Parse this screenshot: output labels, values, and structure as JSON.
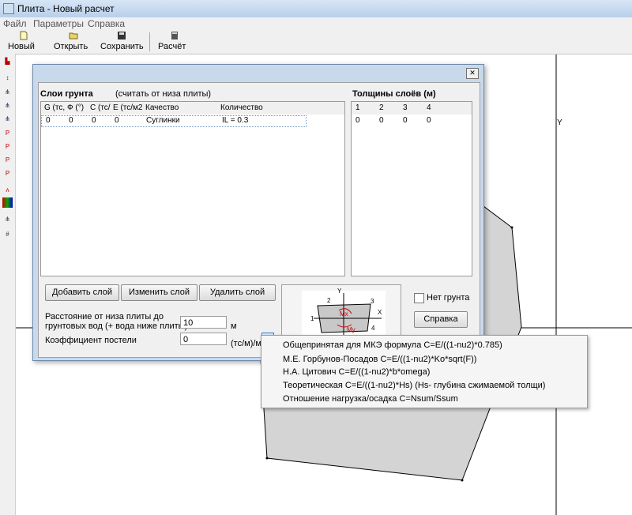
{
  "window": {
    "title": "Плита - Новый расчет"
  },
  "menu": [
    "Файл",
    "Параметры",
    "Справка"
  ],
  "toolbar": {
    "new": "Новый",
    "open": "Открыть",
    "save": "Сохранить",
    "calc": "Расчёт"
  },
  "canvas": {
    "y_axis_label": "Y"
  },
  "dialog": {
    "close_glyph": "✕",
    "layers_title": "Слои грунта",
    "layers_note": "(считать от низа плиты)",
    "layers_columns": [
      "G (тс,",
      "Ф (°)",
      "С (тс/",
      "Е (тс/м2",
      "Качество",
      "Количество"
    ],
    "layers_row": [
      "0",
      "0",
      "0",
      "0",
      "Суглинки",
      "IL = 0.3"
    ],
    "thickness_title": "Толщины слоёв (м)",
    "thickness_columns": [
      "1",
      "2",
      "3",
      "4"
    ],
    "thickness_row": [
      "0",
      "0",
      "0",
      "0"
    ],
    "add_layer": "Добавить слой",
    "edit_layer": "Изменить слой",
    "delete_layer": "Удалить слой",
    "groundwater_label_1": "Расстояние от низа плиты до",
    "groundwater_label_2": "грунтовых вод (+ вода ниже плиты)",
    "groundwater_value": "10",
    "groundwater_unit": "м",
    "coef_label": "Коэффициент постели",
    "coef_value": "0",
    "coef_unit": "(тс/м)/м",
    "no_soil": "Нет грунта",
    "help": "Справка",
    "diagram_y": "Y",
    "diagram_x": "X",
    "diagram_1": "1",
    "diagram_2": "2",
    "diagram_3": "3",
    "diagram_4": "4",
    "diagram_mx": "Mx",
    "diagram_my": "My"
  },
  "popup": [
    "Общепринятая для МКЭ формула С=E/((1-nu2)*0.785)",
    "М.Е. Горбунов-Посадов С=E/((1-nu2)*Ko*sqrt(F))",
    "Н.А. Цитович С=E/((1-nu2)*b*omega)",
    "Теоретическая  С=E/((1-nu2)*Hs)   (Hs- глубина сжимаемой толщи)",
    "Отношение нагрузка/осадка С=Nsum/Ssum"
  ]
}
